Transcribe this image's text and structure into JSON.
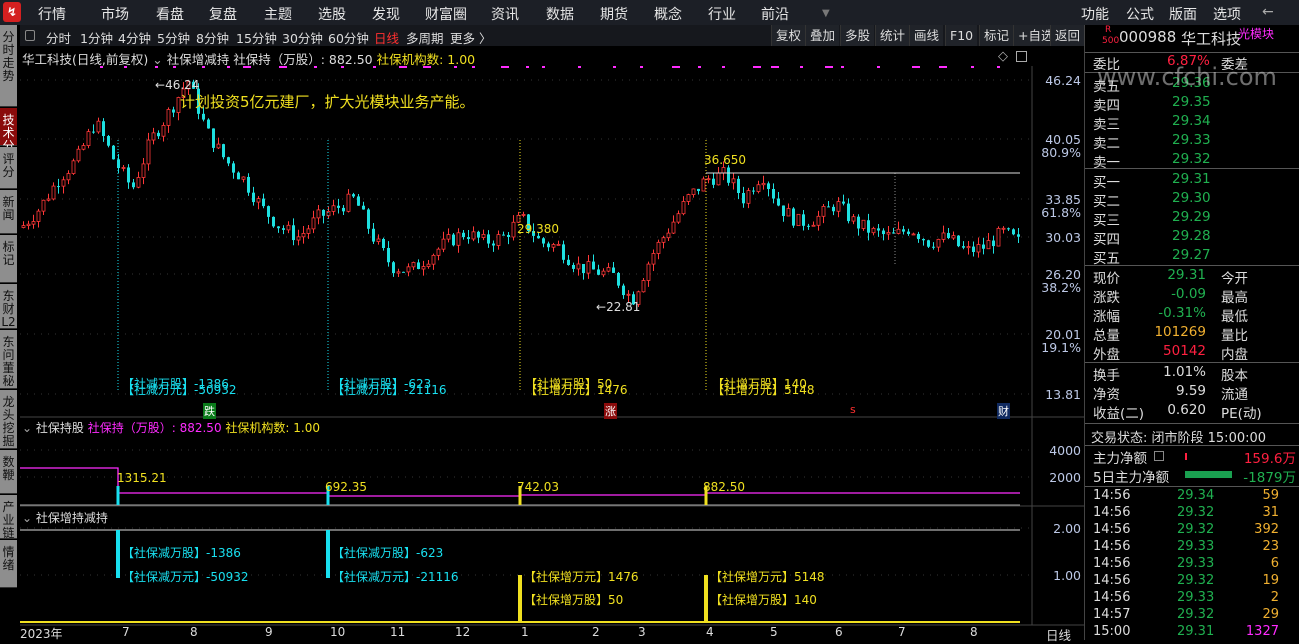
{
  "menu": [
    "行情",
    "市场",
    "看盘",
    "复盘",
    "主题",
    "选股",
    "发现",
    "财富圈",
    "资讯",
    "数据",
    "期货",
    "概念",
    "行业",
    "前沿"
  ],
  "menu_right": [
    "功能",
    "公式",
    "版面",
    "选项"
  ],
  "periods": [
    "分时",
    "1分钟",
    "4分钟",
    "5分钟",
    "8分钟",
    "15分钟",
    "30分钟",
    "60分钟",
    "日线",
    "多周期",
    "更多 〉"
  ],
  "toolbar": [
    "复权",
    "叠加",
    "多股",
    "统计",
    "画线",
    "F10",
    "标记",
    "+自选",
    "返回"
  ],
  "side_tabs": [
    "分时走势",
    "技术分析",
    "评分",
    "新闻",
    "标记",
    "东财L2",
    "东问董秘",
    "龙头挖掘",
    "数鞭",
    "产业链",
    "情绪"
  ],
  "main_header": {
    "name": "华工科技(日线,前复权)",
    "ind": "社保增减持",
    "hold_label": "社保持（万股）: 882.50",
    "org_label": "社保机构数: 1.00"
  },
  "annotation": "计划投资5亿元建厂，扩大光模块业务产能。",
  "price_labels": {
    "high": "46.24",
    "low": "22.81",
    "mark1": "36.650",
    "mark2": "29.380"
  },
  "y_axis": [
    "46.24",
    "40.05",
    "80.9%",
    "33.85",
    "61.8%",
    "30.03",
    "26.20",
    "38.2%",
    "20.01",
    "19.1%",
    "13.81"
  ],
  "events": [
    {
      "a": "【社减万股】-1386",
      "b": "【社减万元】-50932"
    },
    {
      "a": "【社减万股】-623",
      "b": "【社减万元】-21116"
    },
    {
      "a": "【社增万股】50",
      "b": "【社增万元】1476"
    },
    {
      "a": "【社增万股】140",
      "b": "【社增万元】5148"
    }
  ],
  "event_tags": [
    "跌",
    "涨",
    "s",
    "财"
  ],
  "panel2": {
    "name": "社保持股",
    "hold": "社保持（万股）: 882.50",
    "org": "社保机构数: 1.00",
    "values": [
      "1315.21",
      "692.35",
      "742.03",
      "882.50"
    ],
    "axis": [
      "4000",
      "2000"
    ]
  },
  "panel3": {
    "name": "社保增持减持",
    "labels": [
      {
        "a": "【社保减万股】-1386",
        "b": "【社保减万元】-50932"
      },
      {
        "a": "【社保减万股】-623",
        "b": "【社保减万元】-21116"
      },
      {
        "a": "【社保增万元】1476",
        "b": "【社保增万股】50"
      },
      {
        "a": "【社保增万元】5148",
        "b": "【社保增万股】140"
      }
    ],
    "axis": [
      "2.00",
      "1.00"
    ]
  },
  "x_axis": [
    "2023年",
    "7",
    "8",
    "9",
    "10",
    "11",
    "12",
    "1",
    "2",
    "3",
    "4",
    "5",
    "6",
    "7",
    "8"
  ],
  "period_label": "日线",
  "prices": [
    31,
    33,
    36,
    38,
    42,
    38,
    35,
    40,
    43,
    46.2,
    41,
    38,
    36,
    33,
    31,
    30,
    32,
    33,
    34,
    30,
    27,
    26.5,
    28,
    29.5,
    30.5,
    29.5,
    30,
    32,
    29.5,
    29,
    27,
    26.5,
    26,
    23.5,
    28,
    31,
    34,
    36,
    36.5,
    34,
    36.6,
    33,
    31.5,
    32,
    33.5,
    31.5,
    30.5,
    30,
    31,
    29.5,
    30,
    28.5,
    29,
    30.5,
    29.3
  ],
  "quote": {
    "code": "000988",
    "name": "华工科技",
    "concept": "光模块",
    "badge_r": "R",
    "badge_n": "500",
    "wb_label": "委比",
    "wb": "6.87%",
    "wc_label": "委差",
    "asks": [
      [
        "卖五",
        "29.36"
      ],
      [
        "卖四",
        "29.35"
      ],
      [
        "卖三",
        "29.34"
      ],
      [
        "卖二",
        "29.33"
      ],
      [
        "卖一",
        "29.32"
      ]
    ],
    "bids": [
      [
        "买一",
        "29.31"
      ],
      [
        "买二",
        "29.30"
      ],
      [
        "买三",
        "29.29"
      ],
      [
        "买四",
        "29.28"
      ],
      [
        "买五",
        "29.27"
      ]
    ],
    "stats": [
      [
        "现价",
        "29.31",
        "今开"
      ],
      [
        "涨跌",
        "-0.09",
        "最高"
      ],
      [
        "涨幅",
        "-0.31%",
        "最低"
      ],
      [
        "总量",
        "101269",
        "量比"
      ],
      [
        "外盘",
        "50142",
        "内盘"
      ]
    ],
    "stats2": [
      [
        "换手",
        "1.01%",
        "股本"
      ],
      [
        "净资",
        "9.59",
        "流通"
      ],
      [
        "收益(二)",
        "0.620",
        "PE(动)"
      ]
    ],
    "status": "交易状态: 闭市阶段 15:00:00",
    "flow": [
      [
        "主力净额",
        "159.6万"
      ],
      [
        "5日主力净额",
        "-1879万"
      ]
    ],
    "ticks": [
      [
        "14:56",
        "29.34",
        "59"
      ],
      [
        "14:56",
        "29.32",
        "31"
      ],
      [
        "14:56",
        "29.32",
        "392"
      ],
      [
        "14:56",
        "29.33",
        "23"
      ],
      [
        "14:56",
        "29.33",
        "6"
      ],
      [
        "14:56",
        "29.32",
        "19"
      ],
      [
        "14:56",
        "29.33",
        "2"
      ],
      [
        "14:57",
        "29.32",
        "29"
      ],
      [
        "15:00",
        "29.31",
        "1327"
      ]
    ]
  },
  "watermark": "www.cfchi.com"
}
